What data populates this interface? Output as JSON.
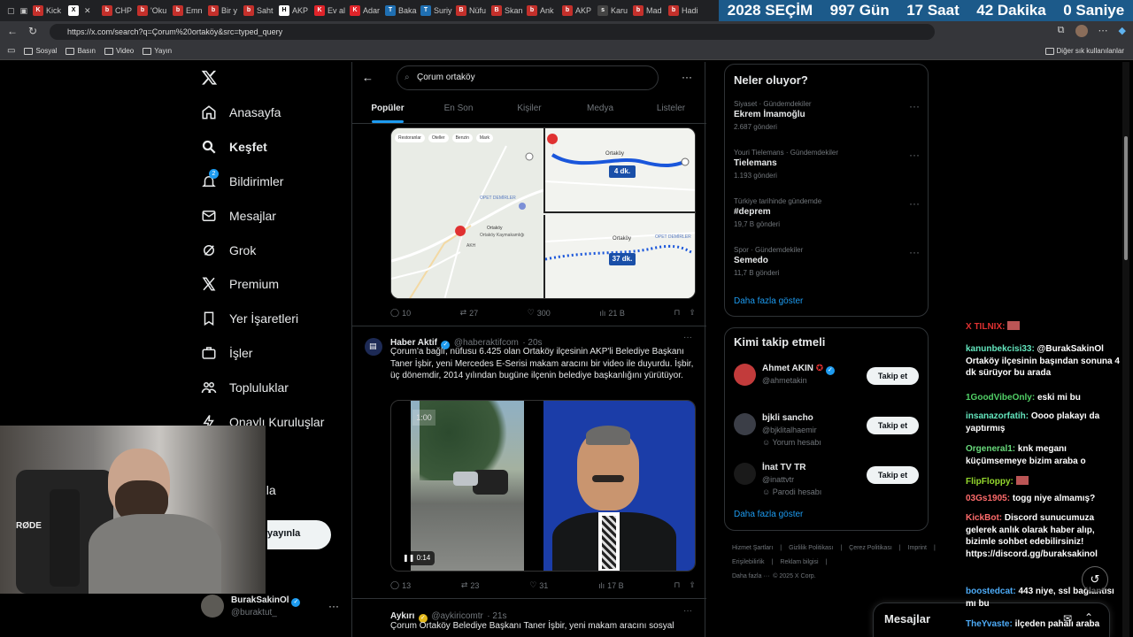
{
  "browser": {
    "tabs": [
      {
        "label": "Kick",
        "color": "#c4302b",
        "glyph": "K"
      },
      {
        "label": "",
        "color": "#ffffff",
        "glyph": "X"
      },
      {
        "label": "CHP",
        "color": "#c4302b",
        "glyph": "b"
      },
      {
        "label": "'Oku",
        "color": "#c4302b",
        "glyph": "b"
      },
      {
        "label": "Emn",
        "color": "#c4302b",
        "glyph": "b"
      },
      {
        "label": "Bir y",
        "color": "#c4302b",
        "glyph": "b"
      },
      {
        "label": "Saht",
        "color": "#c4302b",
        "glyph": "b"
      },
      {
        "label": "AKP",
        "color": "#ffffff",
        "glyph": "H"
      },
      {
        "label": "Ev al",
        "color": "#e0242a",
        "glyph": "K"
      },
      {
        "label": "Adar",
        "color": "#e0242a",
        "glyph": "K"
      },
      {
        "label": "Baka",
        "color": "#1f6fb2",
        "glyph": "T"
      },
      {
        "label": "Suriy",
        "color": "#1f6fb2",
        "glyph": "T"
      },
      {
        "label": "Nüfu",
        "color": "#c4302b",
        "glyph": "B"
      },
      {
        "label": "Skan",
        "color": "#c4302b",
        "glyph": "B"
      },
      {
        "label": "Ank",
        "color": "#c4302b",
        "glyph": "b"
      },
      {
        "label": "AKP",
        "color": "#c4302b",
        "glyph": "b"
      },
      {
        "label": "Karu",
        "color": "#444444",
        "glyph": "s"
      },
      {
        "label": "Mad",
        "color": "#c4302b",
        "glyph": "b"
      },
      {
        "label": "Hadi",
        "color": "#c4302b",
        "glyph": "b"
      }
    ],
    "countdown": {
      "year": "2028",
      "title": "SEÇİM",
      "days": "997",
      "days_label": "Gün",
      "hours": "17",
      "hours_label": "Saat",
      "minutes": "42",
      "minutes_label": "Dakika",
      "seconds": "0",
      "seconds_label": "Saniye"
    },
    "url": "https://x.com/search?q=Çorum%20ortaköy&src=typed_query",
    "bookmarks": [
      "Sosyal",
      "Basın",
      "Video",
      "Yayın"
    ],
    "other_bookmarks": "Diğer sık kullanılanlar"
  },
  "nav": {
    "items": [
      {
        "label": "Anasayfa",
        "icon": "home-icon"
      },
      {
        "label": "Keşfet",
        "icon": "search-icon",
        "bold": true
      },
      {
        "label": "Bildirimler",
        "icon": "bell-icon",
        "badge": "2"
      },
      {
        "label": "Mesajlar",
        "icon": "mail-icon"
      },
      {
        "label": "Grok",
        "icon": "grok-icon"
      },
      {
        "label": "Premium",
        "icon": "x-icon"
      },
      {
        "label": "Yer İşaretleri",
        "icon": "bookmark-icon"
      },
      {
        "label": "İşler",
        "icon": "briefcase-icon"
      },
      {
        "label": "Topluluklar",
        "icon": "people-icon"
      },
      {
        "label": "Onaylı Kuruluşlar",
        "icon": "lightning-icon"
      },
      {
        "label": "azla",
        "icon": ""
      }
    ],
    "post_button": "yayınla",
    "account": {
      "name": "BurakSakinOl",
      "handle": "@buraktut_"
    }
  },
  "search": {
    "query": "Çorum ortaköy",
    "tabs": [
      "Popüler",
      "En Son",
      "Kişiler",
      "Medya",
      "Listeler"
    ],
    "active_tab": "Popüler"
  },
  "map": {
    "filters": [
      "Restoranlar",
      "Oteller",
      "Benzin",
      "Mark"
    ],
    "labels": [
      "OPET DEMİRLER",
      "Ortaköy",
      "Ortaköy Kaymakamlığı",
      "AKH"
    ],
    "route_top_label": "Ortaköy",
    "route_top_time": "4 dk.",
    "route_bottom_label": "Ortaköy",
    "route_bottom_opet": "OPET DEMİRLER",
    "route_bottom_time": "37 dk."
  },
  "tweets": [
    {
      "metrics": {
        "replies": "10",
        "retweets": "27",
        "likes": "300",
        "views": "21 B"
      }
    },
    {
      "name": "Haber Aktif",
      "handle": "@haberaktifcom",
      "time": "· 20s",
      "text": "Çorum'a bağlı, nüfusu 6.425 olan Ortaköy ilçesinin AKP'li Belediye Başkanı Taner İşbir, yeni Mercedes E-Serisi makam aracını bir video ile duyurdu. İşbir, üç dönemdir, 2014 yılından bugüne ilçenin belediye başkanlığını yürütüyor.",
      "video_overlay": "1:00",
      "video_time": "0:14",
      "metrics": {
        "replies": "13",
        "retweets": "23",
        "likes": "31",
        "views": "17 B"
      }
    },
    {
      "name": "Aykırı",
      "handle": "@aykiricomtr",
      "time": "· 21s",
      "text": "Çorum Ortaköy Belediye Başkanı Taner İşbir, yeni makam aracını sosyal"
    }
  ],
  "trends": {
    "title": "Neler oluyor?",
    "items": [
      {
        "meta": "Siyaset · Gündemdekiler",
        "name": "Ekrem İmamoğlu",
        "count": "2.687 gönderi"
      },
      {
        "meta": "Youri Tielemans · Gündemdekiler",
        "name": "Tielemans",
        "count": "1.193 gönderi"
      },
      {
        "meta": "Türkiye tarihinde gündemde",
        "name": "#deprem",
        "count": "19,7 B gönderi"
      },
      {
        "meta": "Spor · Gündemdekiler",
        "name": "Semedo",
        "count": "11,7 B gönderi"
      }
    ],
    "show_more": "Daha fazla göster"
  },
  "who_to_follow": {
    "title": "Kimi takip etmeli",
    "items": [
      {
        "name": "Ahmet AKIN",
        "handle": "@ahmetakin",
        "note": "",
        "button": "Takip et"
      },
      {
        "name": "bjkli sancho",
        "handle": "@bjklitalhaemir",
        "note": "Yorum hesabı",
        "button": "Takip et"
      },
      {
        "name": "İnat TV TR",
        "handle": "@inattvtr",
        "note": "Parodi hesabı",
        "button": "Takip et"
      }
    ],
    "show_more": "Daha fazla göster"
  },
  "footer": {
    "links": [
      "Hizmet Şartları",
      "|",
      "Gizlilik Politikası",
      "|",
      "Çerez Politikası",
      "|",
      "Imprint",
      "|",
      "Erişilebilirlik",
      "|",
      "Reklam bilgisi",
      "|"
    ],
    "more": "Daha fazla ···",
    "copyright": "© 2025 X Corp."
  },
  "messages_drawer": {
    "label": "Mesajlar"
  },
  "chat": [
    {
      "user": "X TILNIX:",
      "color": "#e03131",
      "text": ""
    },
    {
      "user": "kanunbekcisi33:",
      "color": "#63e6be",
      "text": "@BurakSakinOl Ortaköy ilçesinin başından sonuna 4 dk sürüyor bu arada"
    },
    {
      "user": "1GoodVibeOnly:",
      "color": "#51cf66",
      "text": "eski mi bu"
    },
    {
      "user": "insanazorfatih:",
      "color": "#63e6be",
      "text": "Oooo plakayı da yaptırmış"
    },
    {
      "user": "Orgeneral1:",
      "color": "#69db7c",
      "text": "knk meganı küçümsemeye bizim araba o"
    },
    {
      "user": "FlipFloppy:",
      "color": "#94d82d",
      "text": ""
    },
    {
      "user": "03Gs1905:",
      "color": "#ff6b6b",
      "text": "togg niye almamış?"
    },
    {
      "user": "KickBot:",
      "color": "#ff6b6b",
      "text": "Discord sunucumuza gelerek anlık olarak haber alıp, bizimle sohbet edebilirsiniz! https://discord.gg/buraksakinol"
    },
    {
      "user": "boostedcat:",
      "color": "#4dabf7",
      "text": "443 niye, ssl bağlantısı mı bu"
    },
    {
      "user": "TheYvaste:",
      "color": "#4dabf7",
      "text": "ilçeden pahalı araba"
    }
  ],
  "webcam": {
    "mic_brand": "RØDE"
  }
}
